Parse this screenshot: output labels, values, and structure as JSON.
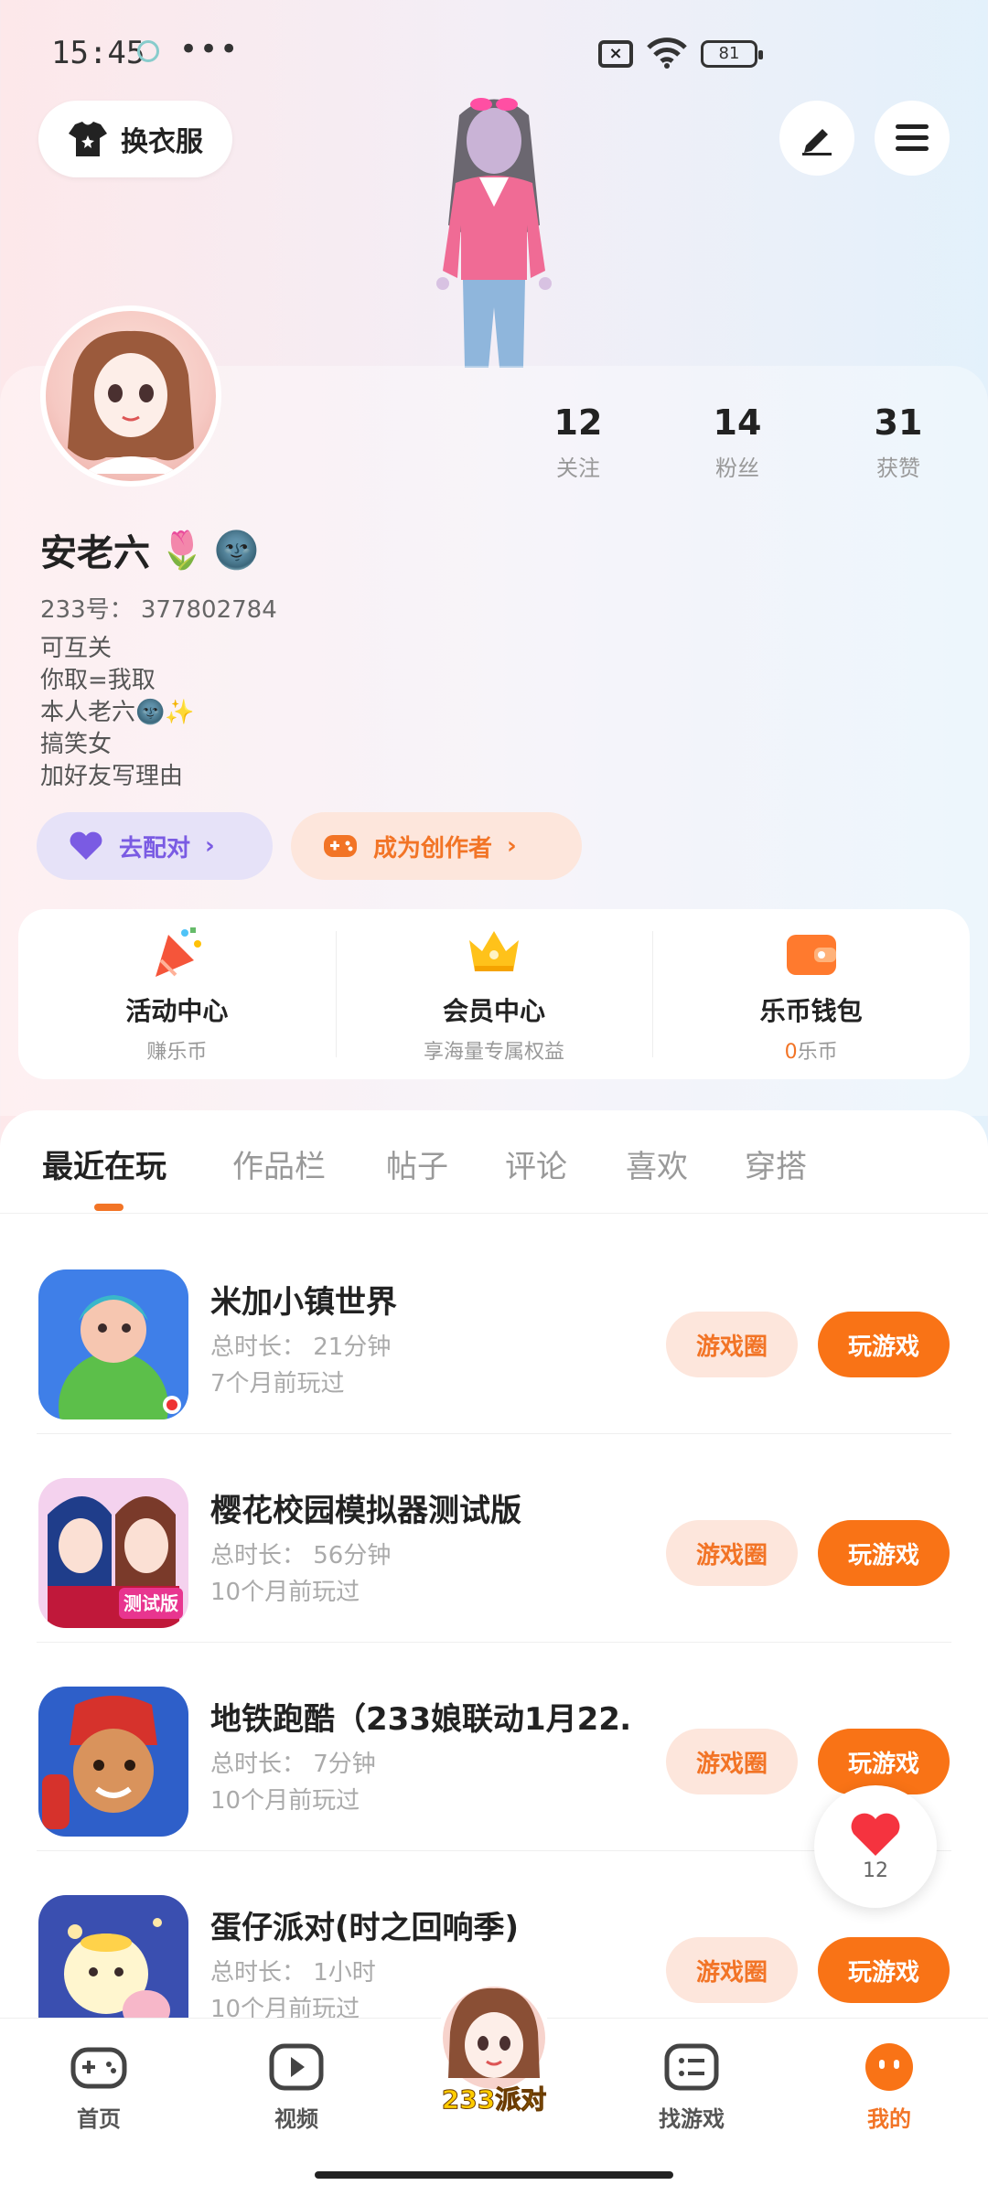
{
  "status_bar": {
    "time": "15:45",
    "more": "•••",
    "battery": "81"
  },
  "header": {
    "outfit_label": "换衣服"
  },
  "profile": {
    "stats": [
      {
        "num": "12",
        "label": "关注"
      },
      {
        "num": "14",
        "label": "粉丝"
      },
      {
        "num": "31",
        "label": "获赞"
      }
    ],
    "name": "安老六",
    "uid": "233号： 377802784",
    "bio": [
      "可互关",
      "你取=我取",
      "本人老六🌚✨",
      "搞笑女",
      "加好友写理由"
    ],
    "match_label": "去配对",
    "creator_label": "成为创作者"
  },
  "features": [
    {
      "title": "活动中心",
      "sub": "赚乐币"
    },
    {
      "title": "会员中心",
      "sub": "享海量专属权益"
    },
    {
      "title": "乐币钱包",
      "sub_num": "0",
      "sub": "乐币"
    }
  ],
  "tabs": [
    "最近在玩",
    "作品栏",
    "帖子",
    "评论",
    "喜欢",
    "穿搭"
  ],
  "games": [
    {
      "title": "米加小镇世界",
      "duration": "总时长： 21分钟",
      "last": "7个月前玩过",
      "circle": "游戏圈",
      "play": "玩游戏"
    },
    {
      "title": "樱花校园模拟器测试版",
      "duration": "总时长： 56分钟",
      "last": "10个月前玩过",
      "circle": "游戏圈",
      "play": "玩游戏"
    },
    {
      "title": "地铁跑酷（233娘联动1月22…",
      "duration": "总时长： 7分钟",
      "last": "10个月前玩过",
      "circle": "游戏圈",
      "play": "玩游戏"
    },
    {
      "title": "蛋仔派对(时之回响季)",
      "duration": "总时长： 1小时",
      "last": "10个月前玩过",
      "circle": "游戏圈",
      "play": "玩游戏"
    }
  ],
  "game_badge_text": "测试版",
  "heart": {
    "count": "12"
  },
  "nav": [
    {
      "label": "首页"
    },
    {
      "label": "视频"
    },
    {
      "label": "233派对"
    },
    {
      "label": "找游戏"
    },
    {
      "label": "我的"
    }
  ],
  "colors": {
    "accent": "#f97316",
    "accent_soft": "#fde6dc",
    "purple": "#7a5be3"
  }
}
